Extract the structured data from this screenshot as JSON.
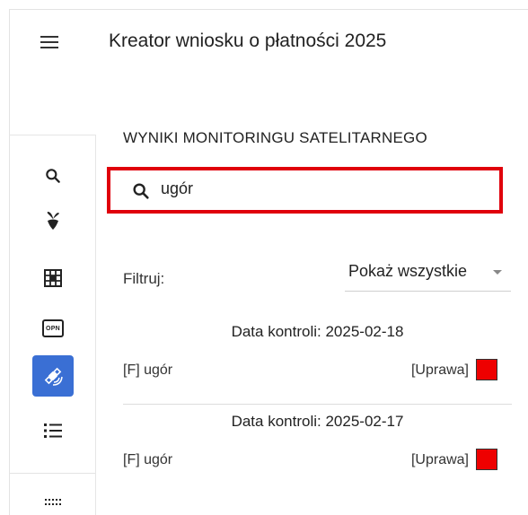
{
  "header": {
    "title": "Kreator wniosku o płatności 2025"
  },
  "sidebar": {
    "items": [
      {
        "icon": "search-icon"
      },
      {
        "icon": "crop-plant-icon"
      },
      {
        "icon": "grid-map-icon"
      },
      {
        "icon": "opn-badge-icon",
        "badge_text": "OPN"
      },
      {
        "icon": "satellite-icon",
        "active": true
      },
      {
        "icon": "list-icon"
      },
      {
        "icon": "dotted-box-icon"
      }
    ]
  },
  "main": {
    "section_title": "WYNIKI MONITORINGU SATELITARNEGO",
    "search": {
      "value": "ugór",
      "highlight_color": "#e0000b"
    },
    "filter": {
      "label": "Filtruj:",
      "selected": "Pokaż wszystkie"
    },
    "results": [
      {
        "date_label": "Data kontroli: 2025-02-18",
        "name": "[F] ugór",
        "type": "[Uprawa]",
        "status_color": "#ee0000"
      },
      {
        "date_label": "Data kontroli: 2025-02-17",
        "name": "[F] ugór",
        "type": "[Uprawa]",
        "status_color": "#ee0000"
      }
    ]
  }
}
